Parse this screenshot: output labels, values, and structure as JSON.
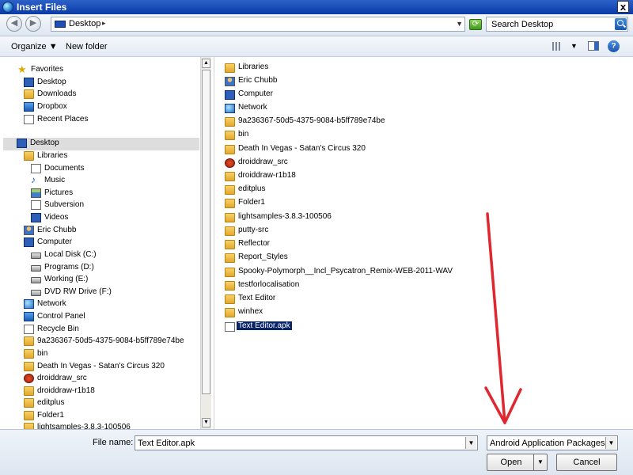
{
  "window": {
    "title": "Insert Files",
    "close": "x"
  },
  "address": {
    "crumb": "Desktop",
    "arrow": "▸",
    "dropdown": "▼",
    "search_placeholder": "Search Desktop"
  },
  "toolbar": {
    "organize": "Organize ▼",
    "new_folder": "New folder",
    "view_dropdown": "▼",
    "help": "?"
  },
  "nav": {
    "items": [
      {
        "label": "Favorites",
        "icon": "favorites-star-icon"
      },
      {
        "label": "Desktop",
        "icon": "desktop-icon"
      },
      {
        "label": "Downloads",
        "icon": "downloads-icon"
      },
      {
        "label": "Dropbox",
        "icon": "dropbox-icon"
      },
      {
        "label": "Recent Places",
        "icon": "recent-places-icon"
      },
      {
        "label": "Desktop",
        "icon": "desktop-icon"
      },
      {
        "label": "Libraries",
        "icon": "libraries-icon"
      },
      {
        "label": "Documents",
        "icon": "documents-icon"
      },
      {
        "label": "Music",
        "icon": "music-icon"
      },
      {
        "label": "Pictures",
        "icon": "pictures-icon"
      },
      {
        "label": "Subversion",
        "icon": "subversion-icon"
      },
      {
        "label": "Videos",
        "icon": "videos-icon"
      },
      {
        "label": "Eric Chubb",
        "icon": "user-folder-icon"
      },
      {
        "label": "Computer",
        "icon": "computer-icon"
      },
      {
        "label": "Local Disk (C:)",
        "icon": "local-disk-icon"
      },
      {
        "label": "Programs (D:)",
        "icon": "drive-icon"
      },
      {
        "label": "Working (E:)",
        "icon": "drive-icon"
      },
      {
        "label": "DVD RW Drive (F:)",
        "icon": "dvd-drive-icon"
      },
      {
        "label": "Network",
        "icon": "network-icon"
      },
      {
        "label": "Control Panel",
        "icon": "control-panel-icon"
      },
      {
        "label": "Recycle Bin",
        "icon": "recycle-bin-icon"
      },
      {
        "label": "9a236367-50d5-4375-9084-b5ff789e74be",
        "icon": "folder-icon"
      },
      {
        "label": "bin",
        "icon": "folder-icon"
      },
      {
        "label": "Death In Vegas - Satan's Circus 320",
        "icon": "folder-icon"
      },
      {
        "label": "droiddraw_src",
        "icon": "droiddraw-icon"
      },
      {
        "label": "droiddraw-r1b18",
        "icon": "folder-icon"
      },
      {
        "label": "editplus",
        "icon": "folder-icon"
      },
      {
        "label": "Folder1",
        "icon": "folder-icon"
      },
      {
        "label": "lightsamples-3.8.3-100506",
        "icon": "folder-icon"
      }
    ]
  },
  "files": {
    "items": [
      {
        "label": "Libraries",
        "icon": "libraries-icon"
      },
      {
        "label": "Eric Chubb",
        "icon": "user-folder-icon"
      },
      {
        "label": "Computer",
        "icon": "computer-icon"
      },
      {
        "label": "Network",
        "icon": "network-icon"
      },
      {
        "label": "9a236367-50d5-4375-9084-b5ff789e74be",
        "icon": "folder-icon"
      },
      {
        "label": "bin",
        "icon": "folder-icon"
      },
      {
        "label": "Death In Vegas - Satan's Circus 320",
        "icon": "folder-icon"
      },
      {
        "label": "droiddraw_src",
        "icon": "droiddraw-icon"
      },
      {
        "label": "droiddraw-r1b18",
        "icon": "folder-icon"
      },
      {
        "label": "editplus",
        "icon": "folder-icon"
      },
      {
        "label": "Folder1",
        "icon": "folder-icon"
      },
      {
        "label": "lightsamples-3.8.3-100506",
        "icon": "folder-icon"
      },
      {
        "label": "putty-src",
        "icon": "folder-icon"
      },
      {
        "label": "Reflector",
        "icon": "folder-icon"
      },
      {
        "label": "Report_Styles",
        "icon": "folder-icon"
      },
      {
        "label": "Spooky-Polymorph__Incl_Psycatron_Remix-WEB-2011-WAV",
        "icon": "folder-icon"
      },
      {
        "label": "testforlocalisation",
        "icon": "folder-icon"
      },
      {
        "label": "Text Editor",
        "icon": "folder-icon"
      },
      {
        "label": "winhex",
        "icon": "folder-icon"
      },
      {
        "label": "Text Editor.apk",
        "icon": "apk-file-icon"
      }
    ],
    "selected_index": 19
  },
  "footer": {
    "file_name_label": "File name:",
    "file_name_value": "Text Editor.apk",
    "file_type_value": "Android Application Packages (",
    "open_label": "Open",
    "cancel_label": "Cancel",
    "dropdown": "▼"
  }
}
